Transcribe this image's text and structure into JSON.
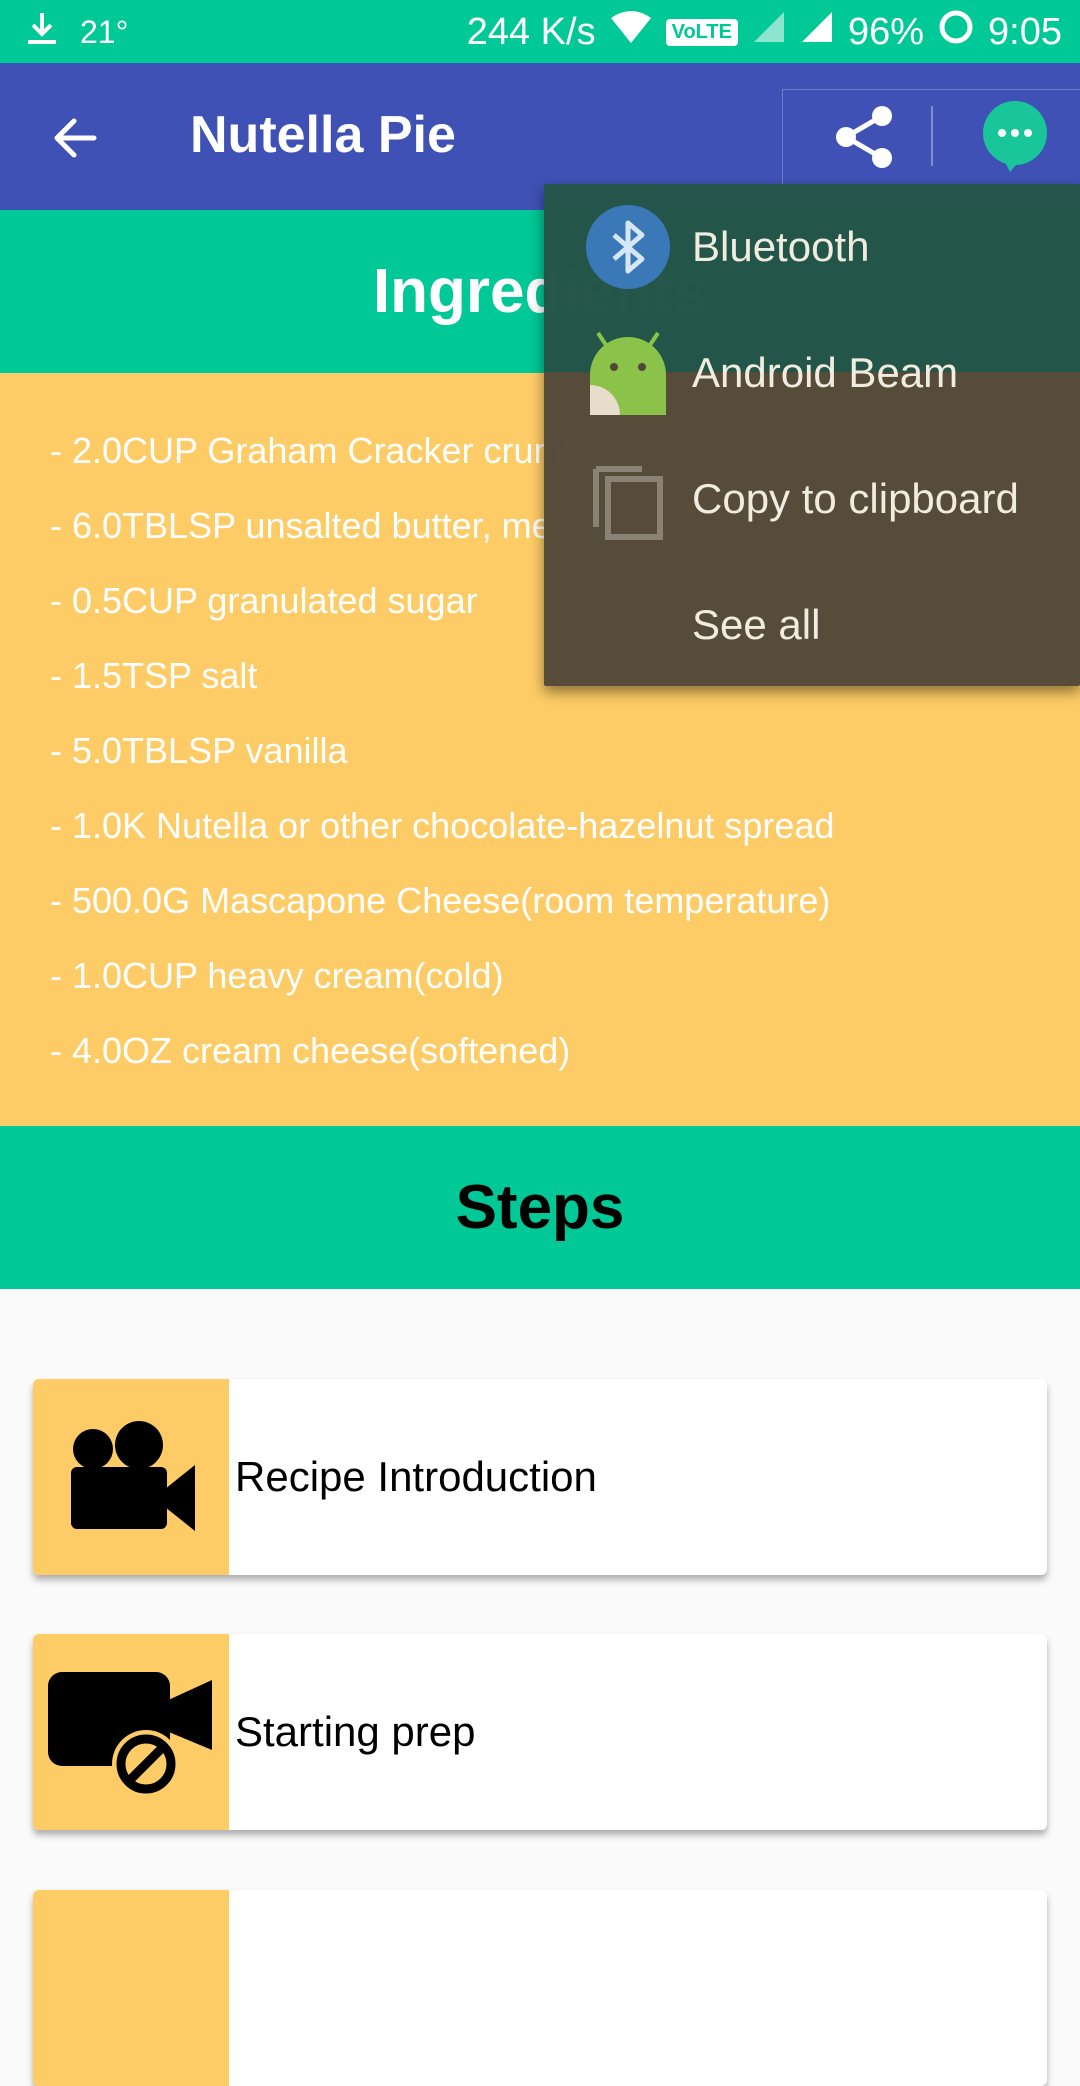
{
  "status_bar": {
    "temperature": "21°",
    "network_speed": "244 K/s",
    "volte": "VoLTE",
    "battery": "96%",
    "time": "9:05",
    "icons": [
      "download-icon",
      "wifi-icon",
      "signal-icon",
      "battery-icon"
    ]
  },
  "app_bar": {
    "title": "Nutella Pie",
    "icons": [
      "back-arrow-icon",
      "share-icon",
      "chat-bubble-icon"
    ],
    "color": "#3f51b5"
  },
  "ingredients": {
    "heading": "Ingredients",
    "items": [
      "- 2.0CUP Graham Cracker crumbs",
      "- 6.0TBLSP unsalted butter, melted",
      "- 0.5CUP granulated sugar",
      "- 1.5TSP salt",
      "- 5.0TBLSP vanilla",
      "- 1.0K Nutella or other chocolate-hazelnut spread",
      "- 500.0G Mascapone Cheese(room temperature)",
      "- 1.0CUP heavy cream(cold)",
      "- 4.0OZ cream cheese(softened)"
    ],
    "background_color": "#fecc66"
  },
  "steps": {
    "heading": "Steps",
    "items": [
      {
        "label": "Recipe Introduction",
        "icon": "video-camera-icon"
      },
      {
        "label": "Starting prep",
        "icon": "video-off-icon"
      }
    ]
  },
  "share_menu": {
    "items": [
      {
        "label": "Bluetooth",
        "icon": "bluetooth-icon"
      },
      {
        "label": "Android Beam",
        "icon": "android-beam-icon"
      },
      {
        "label": "Copy to clipboard",
        "icon": "copy-icon"
      },
      {
        "label": "See all",
        "icon": ""
      }
    ]
  },
  "colors": {
    "accent_teal": "#00c896",
    "primary_indigo": "#3f51b5",
    "ingredient_yellow": "#fecc66"
  }
}
